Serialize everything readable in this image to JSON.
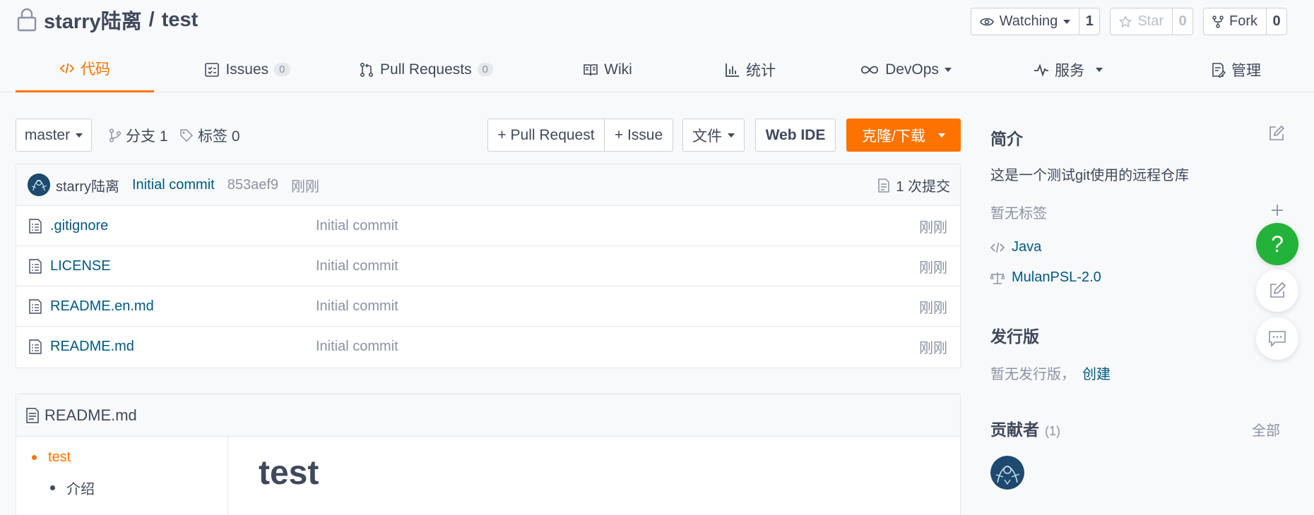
{
  "repo": {
    "owner": "starry陆离",
    "separator": "/",
    "name": "test"
  },
  "actions": [
    {
      "label": "Watching",
      "count": "1"
    },
    {
      "label": "Star",
      "count": "0"
    },
    {
      "label": "Fork",
      "count": "0"
    }
  ],
  "tabs": [
    {
      "label": "代码",
      "badge": ""
    },
    {
      "label": "Issues",
      "badge": "0"
    },
    {
      "label": "Pull Requests",
      "badge": "0"
    },
    {
      "label": "Wiki",
      "badge": ""
    },
    {
      "label": "统计",
      "badge": ""
    },
    {
      "label": "DevOps",
      "badge": ""
    },
    {
      "label": "服务",
      "badge": ""
    },
    {
      "label": "管理",
      "badge": ""
    }
  ],
  "toolbar": {
    "branch": "master",
    "branches": "分支 1",
    "tags": "标签 0",
    "pull_request": "+ Pull Request",
    "issue": "+ Issue",
    "files": "文件",
    "web_ide": "Web IDE",
    "clone": "克隆/下载"
  },
  "last_commit": {
    "author": "starry陆离",
    "message": "Initial commit",
    "sha": "853aef9",
    "time": "刚刚",
    "count": "1 次提交"
  },
  "files": [
    {
      "name": ".gitignore",
      "message": "Initial commit",
      "time": "刚刚"
    },
    {
      "name": "LICENSE",
      "message": "Initial commit",
      "time": "刚刚"
    },
    {
      "name": "README.en.md",
      "message": "Initial commit",
      "time": "刚刚"
    },
    {
      "name": "README.md",
      "message": "Initial commit",
      "time": "刚刚"
    }
  ],
  "readme": {
    "filename": "README.md",
    "toc": [
      "test",
      "介绍"
    ],
    "heading": "test"
  },
  "sidebar": {
    "intro_title": "简介",
    "description": "这是一个测试git使用的远程仓库",
    "no_tags": "暂无标签",
    "language": "Java",
    "license": "MulanPSL-2.0",
    "release_title": "发行版",
    "no_release": "暂无发行版，",
    "create": "创建",
    "contributors_title": "贡献者",
    "contributors_count": "(1)",
    "all": "全部"
  },
  "help_fab": "?",
  "colors": {
    "accent": "#fe7300",
    "link": "#005980",
    "help": "#23b33b"
  }
}
